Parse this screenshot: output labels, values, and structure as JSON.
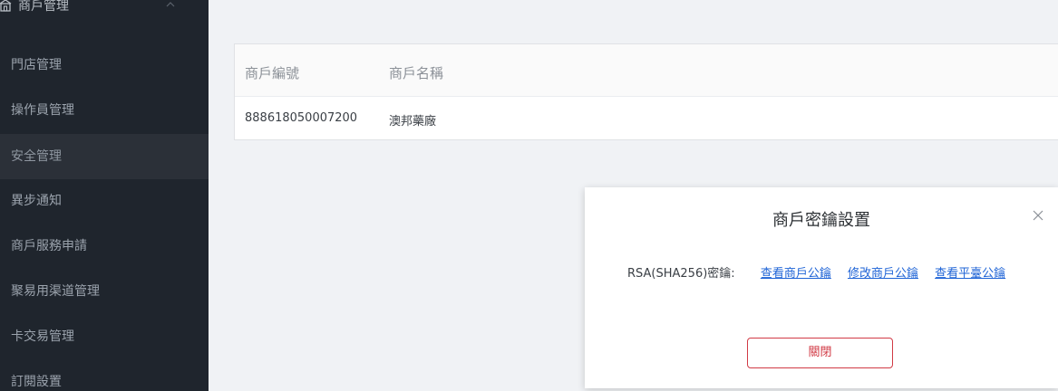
{
  "sidebar": {
    "header": {
      "icon": "store-icon",
      "label": "商戶管理",
      "chevron": "chevron-up-icon"
    },
    "items": [
      {
        "label": "門店管理",
        "active": false
      },
      {
        "label": "操作員管理",
        "active": false
      },
      {
        "label": "安全管理",
        "active": true
      },
      {
        "label": "異步通知",
        "active": false
      },
      {
        "label": "商戶服務申請",
        "active": false
      },
      {
        "label": "聚易用渠道管理",
        "active": false
      },
      {
        "label": "卡交易管理",
        "active": false
      },
      {
        "label": "訂閱設置",
        "active": false
      }
    ]
  },
  "table": {
    "columns": [
      "商戶編號",
      "商戶名稱"
    ],
    "rows": [
      [
        "888618050007200",
        "澳邦藥廠"
      ]
    ]
  },
  "modal": {
    "title": "商戶密鑰設置",
    "key_label": "RSA(SHA256)密鑰:",
    "links": [
      "查看商戶公鑰",
      "修改商戶公鑰",
      "查看平臺公鑰"
    ],
    "close_button": "關閉",
    "close_icon": "close-icon"
  },
  "colors": {
    "sidebar_bg": "#1f252d",
    "sidebar_active_bg": "#2b3038",
    "link": "#1e63d6",
    "danger": "#d13a45",
    "page_bg": "#f0f2f5"
  }
}
